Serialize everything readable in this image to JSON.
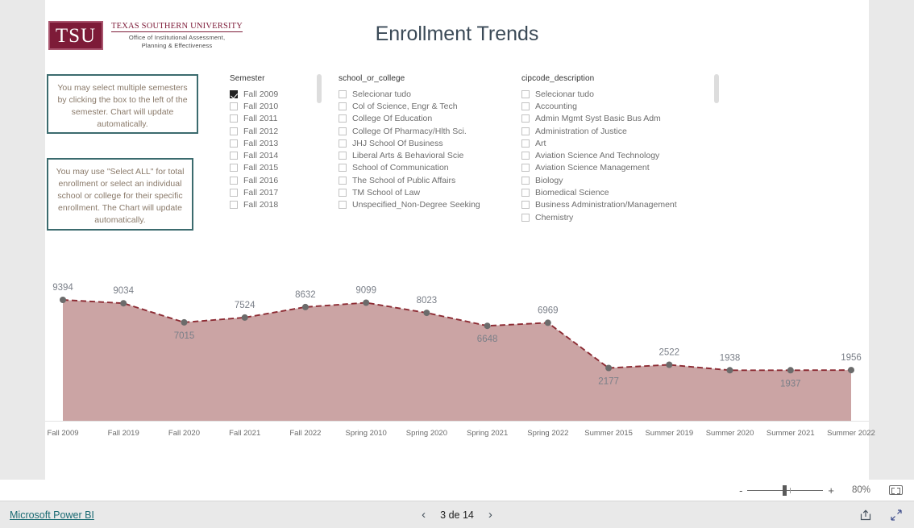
{
  "logo": {
    "mark": "TSU",
    "university": "TEXAS SOUTHERN UNIVERSITY",
    "office_line1": "Office of Institutional Assessment,",
    "office_line2": "Planning & Effectiveness"
  },
  "report": {
    "title": "Enrollment Trends"
  },
  "info_boxes": [
    {
      "text": "You may select multiple semesters by clicking the box to the left of the semester. Chart will update automatically."
    },
    {
      "text": "You may use \"Select ALL\" for total enrollment or select an individual school or college for their specific enrollment. The Chart will update automatically."
    }
  ],
  "slicers": [
    {
      "title": "Semester",
      "items": [
        {
          "label": "Fall 2009",
          "checked": true
        },
        {
          "label": "Fall 2010",
          "checked": false
        },
        {
          "label": "Fall 2011",
          "checked": false
        },
        {
          "label": "Fall 2012",
          "checked": false
        },
        {
          "label": "Fall 2013",
          "checked": false
        },
        {
          "label": "Fall 2014",
          "checked": false
        },
        {
          "label": "Fall 2015",
          "checked": false
        },
        {
          "label": "Fall 2016",
          "checked": false
        },
        {
          "label": "Fall 2017",
          "checked": false
        },
        {
          "label": "Fall 2018",
          "checked": false
        }
      ],
      "scrollbar": true
    },
    {
      "title": "school_or_college",
      "items": [
        {
          "label": "Selecionar tudo",
          "checked": false
        },
        {
          "label": "Col of Science, Engr & Tech",
          "checked": false
        },
        {
          "label": "College Of Education",
          "checked": false
        },
        {
          "label": "College Of Pharmacy/Hlth Sci.",
          "checked": false
        },
        {
          "label": "JHJ School Of Business",
          "checked": false
        },
        {
          "label": "Liberal Arts & Behavioral Scie",
          "checked": false
        },
        {
          "label": "School of Communication",
          "checked": false
        },
        {
          "label": "The School of Public Affairs",
          "checked": false
        },
        {
          "label": "TM School of Law",
          "checked": false
        },
        {
          "label": "Unspecified_Non-Degree Seeking",
          "checked": false
        }
      ],
      "scrollbar": false
    },
    {
      "title": "cipcode_description",
      "items": [
        {
          "label": "Selecionar tudo",
          "checked": false
        },
        {
          "label": "Accounting",
          "checked": false
        },
        {
          "label": "Admin Mgmt Syst Basic Bus Adm",
          "checked": false
        },
        {
          "label": "Administration of Justice",
          "checked": false
        },
        {
          "label": "Art",
          "checked": false
        },
        {
          "label": "Aviation Science And Technology",
          "checked": false
        },
        {
          "label": "Aviation Science Management",
          "checked": false
        },
        {
          "label": "Biology",
          "checked": false
        },
        {
          "label": "Biomedical Science",
          "checked": false
        },
        {
          "label": "Business Administration/Management",
          "checked": false
        },
        {
          "label": "Chemistry",
          "checked": false
        }
      ],
      "scrollbar": true
    }
  ],
  "chart_data": {
    "type": "area",
    "title": "Enrollment Trends",
    "xlabel": "",
    "ylabel": "",
    "grid": false,
    "legend": "none",
    "ylim": [
      0,
      9394
    ],
    "categories": [
      "Fall 2009",
      "Fall 2019",
      "Fall 2020",
      "Fall 2021",
      "Fall 2022",
      "Spring 2010",
      "Spring 2020",
      "Spring 2021",
      "Spring 2022",
      "Summer 2015",
      "Summer 2019",
      "Summer 2020",
      "Summer 2021",
      "Summer 2022"
    ],
    "values": [
      9394,
      9034,
      7015,
      7524,
      8632,
      9099,
      8023,
      6648,
      6969,
      2177,
      2522,
      1938,
      1937,
      1956
    ],
    "label_positions": [
      "above",
      "above",
      "below",
      "above",
      "above",
      "above",
      "above",
      "below",
      "above",
      "below",
      "above",
      "above",
      "below",
      "above"
    ],
    "colors": {
      "line": "#8c2b33",
      "fill": "#cba4a4",
      "marker": "#6b6b6b",
      "label": "#7a7f88"
    }
  },
  "toolbar": {
    "zoom_out": "-",
    "zoom_in": "+",
    "zoom_value": "80%",
    "fit_icon": "fit-to-page-icon"
  },
  "footer": {
    "brand_link": "Microsoft Power BI",
    "prev_arrow": "‹",
    "next_arrow": "›",
    "page_text": "3 de 14",
    "share_icon": "share-icon",
    "fullscreen_icon": "fullscreen-icon"
  }
}
